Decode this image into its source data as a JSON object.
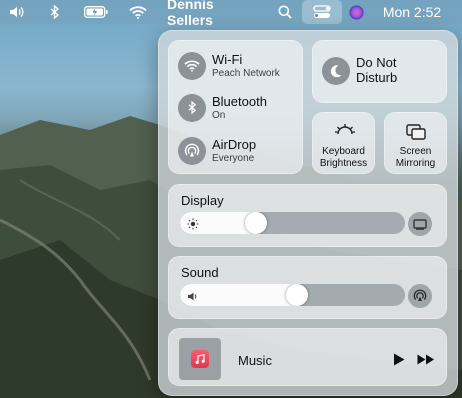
{
  "menubar": {
    "user": "Dennis Sellers",
    "clock": "Mon 2:52",
    "icons": [
      "volume-icon",
      "bluetooth-icon",
      "battery-icon",
      "wifi-icon",
      "search-icon",
      "control-center-icon",
      "siri-icon"
    ]
  },
  "control_center": {
    "wifi": {
      "title": "Wi-Fi",
      "subtitle": "Peach Network"
    },
    "bluetooth": {
      "title": "Bluetooth",
      "subtitle": "On"
    },
    "airdrop": {
      "title": "AirDrop",
      "subtitle": "Everyone"
    },
    "dnd": {
      "label": "Do Not Disturb"
    },
    "keyboard_brightness": {
      "label": "Keyboard Brightness"
    },
    "screen_mirroring": {
      "label": "Screen Mirroring"
    },
    "display": {
      "title": "Display",
      "level": 0.32
    },
    "sound": {
      "title": "Sound",
      "level": 0.52
    },
    "music": {
      "label": "Music"
    }
  },
  "colors": {
    "music_accent": "#f0475a",
    "menubar_text": "#ffffff"
  }
}
